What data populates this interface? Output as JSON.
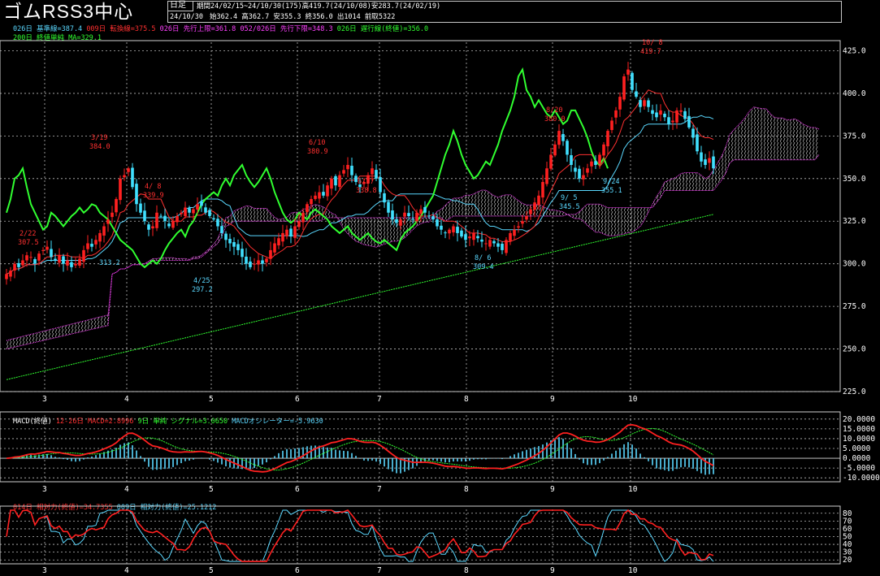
{
  "header": {
    "title": "ゴムRSS3中心",
    "period_type": "日足",
    "summary": "期間24/02/15~24/10/30(175)高419.7(24/10/08)安283.7(24/02/19)",
    "last_date": "24/10/30",
    "last_ohlc": "始362.4 高362.7 安355.3 終356.0 出1014 前取5322"
  },
  "legend_top": {
    "line1": [
      {
        "text": "026日 基準線=387.4",
        "color": "#5ad8ff"
      },
      {
        "text": "009日 転換線=375.5",
        "color": "#ff3030"
      },
      {
        "text": "026日 先行上限=361.8",
        "color": "#ff40ff"
      },
      {
        "text": "052/026日 先行下限=348.3",
        "color": "#ff40ff"
      },
      {
        "text": "026日 遅行線(終値)=356.0",
        "color": "#30ff30"
      }
    ],
    "line2": [
      {
        "text": "200日 終値単純 MA=329.1",
        "color": "#30ff30"
      }
    ]
  },
  "legend_macd": [
    {
      "text": "MACD(終値)",
      "color": "#ffffff"
    },
    {
      "text": "12-26日 MACD=2.8996",
      "color": "#ff3030"
    },
    {
      "text": "9日 単純 シグナル=3.0650",
      "color": "#30ff30"
    },
    {
      "text": "MACDオシレーター=-5.9630",
      "color": "#5ad8ff"
    }
  ],
  "legend_rsi": [
    {
      "text": "014日 相対力(終値)=34.7355",
      "color": "#ff3030"
    },
    {
      "text": "009日 相対力(終値)=25.1212",
      "color": "#5ad8ff"
    }
  ],
  "chart_data": [
    {
      "type": "candlestick",
      "ylim": [
        225,
        430
      ],
      "y_ticks": [
        "425.0",
        "400.0",
        "375.0",
        "350.0",
        "325.0",
        "300.0",
        "275.0",
        "250.0",
        "225.0"
      ],
      "x_ticks": [
        "3",
        "4",
        "5",
        "6",
        "7",
        "8",
        "9",
        "10"
      ],
      "close": [
        294,
        296,
        300,
        298,
        302,
        305,
        304,
        300,
        306,
        308,
        310,
        304,
        302,
        305,
        300,
        302,
        298,
        300,
        303,
        308,
        312,
        310,
        314,
        318,
        322,
        326,
        330,
        338,
        350,
        352,
        356,
        345,
        335,
        330,
        325,
        320,
        322,
        330,
        328,
        325,
        322,
        325,
        328,
        330,
        333,
        330,
        332,
        335,
        334,
        330,
        328,
        326,
        322,
        318,
        314,
        312,
        310,
        308,
        304,
        300,
        298,
        300,
        302,
        300,
        303,
        308,
        312,
        315,
        318,
        320,
        316,
        322,
        325,
        330,
        335,
        338,
        340,
        342,
        340,
        346,
        350,
        346,
        352,
        355,
        358,
        352,
        348,
        345,
        348,
        352,
        356,
        350,
        342,
        336,
        330,
        326,
        324,
        326,
        330,
        328,
        326,
        330,
        332,
        330,
        328,
        326,
        322,
        320,
        318,
        320,
        322,
        318,
        316,
        314,
        316,
        318,
        315,
        313,
        312,
        314,
        312,
        310,
        308,
        314,
        318,
        320,
        322,
        325,
        328,
        332,
        336,
        340,
        348,
        356,
        364,
        370,
        378,
        372,
        364,
        358,
        354,
        350,
        352,
        356,
        360,
        358,
        364,
        370,
        378,
        384,
        390,
        398,
        410,
        414,
        402,
        398,
        392,
        396,
        392,
        388,
        386,
        390,
        386,
        382,
        384,
        390,
        390,
        385,
        380,
        374,
        366,
        360,
        358,
        362,
        356
      ],
      "annotations_high": [
        {
          "label": "3/19",
          "value": "384.0"
        },
        {
          "label": "4/ 8",
          "value": "339.9"
        },
        {
          "label": "6/10",
          "value": "380.9"
        },
        {
          "label": "6/27",
          "value": "338.8"
        },
        {
          "label": "8/20",
          "value": "380.0"
        },
        {
          "label": "10/ 8",
          "value": "419.7"
        },
        {
          "label": "2/22",
          "value": "307.5"
        }
      ],
      "annotations_low": [
        {
          "label": "4/25",
          "value": "297.2"
        },
        {
          "label": "8/ 6",
          "value": "309.4"
        },
        {
          "label": "9/ 5",
          "value": "345.5"
        },
        {
          "label": "9/24",
          "value": "355.1"
        },
        {
          "label": "",
          "value": "313.2"
        }
      ],
      "series": [
        {
          "name": "基準線",
          "color": "#5ad8ff"
        },
        {
          "name": "転換線",
          "color": "#ff3030"
        },
        {
          "name": "先行上限",
          "color": "#ff40ff"
        },
        {
          "name": "先行下限",
          "color": "#ff40ff"
        },
        {
          "name": "遅行線",
          "color": "#30ff30"
        },
        {
          "name": "MA200",
          "color": "#30ff30"
        }
      ]
    },
    {
      "type": "line",
      "ylim": [
        -12,
        22
      ],
      "y_ticks": [
        "20.0000",
        "15.0000",
        "10.0000",
        "5.0000",
        "0.0000",
        "-5.0000",
        "-10.0000"
      ],
      "x_ticks": [
        "3",
        "4",
        "5",
        "6",
        "7",
        "8",
        "9",
        "10"
      ]
    },
    {
      "type": "line",
      "ylim": [
        15,
        85
      ],
      "y_ticks": [
        "80",
        "70",
        "60",
        "50",
        "40",
        "30",
        "20"
      ],
      "x_ticks": [
        "3",
        "4",
        "5",
        "6",
        "7",
        "8",
        "9",
        "10"
      ]
    }
  ]
}
